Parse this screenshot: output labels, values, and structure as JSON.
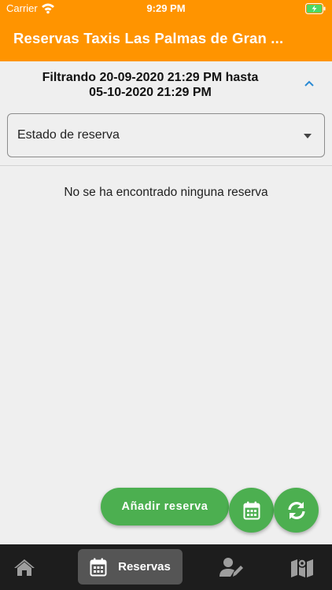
{
  "status_bar": {
    "carrier": "Carrier",
    "time": "9:29 PM"
  },
  "header": {
    "title": "Reservas Taxis Las Palmas de Gran ..."
  },
  "filter": {
    "range_line1": "Filtrando 20-09-2020 21:29 PM hasta",
    "range_line2": "05-10-2020 21:29 PM",
    "status_select_label": "Estado de reserva"
  },
  "empty_message": "No se ha encontrado ninguna reserva",
  "actions": {
    "add_label": "Añadir reserva"
  },
  "bottom_nav": {
    "active_label": "Reservas"
  },
  "colors": {
    "header": "#ff9400",
    "accent": "#4caf50",
    "nav_bg": "#1d1d1d",
    "chevron": "#2a8ad4"
  },
  "icons": [
    "wifi-icon",
    "battery-charging-icon",
    "chevron-up-icon",
    "dropdown-arrow-icon",
    "calendar-icon",
    "refresh-icon",
    "home-icon",
    "user-edit-icon",
    "map-icon"
  ]
}
